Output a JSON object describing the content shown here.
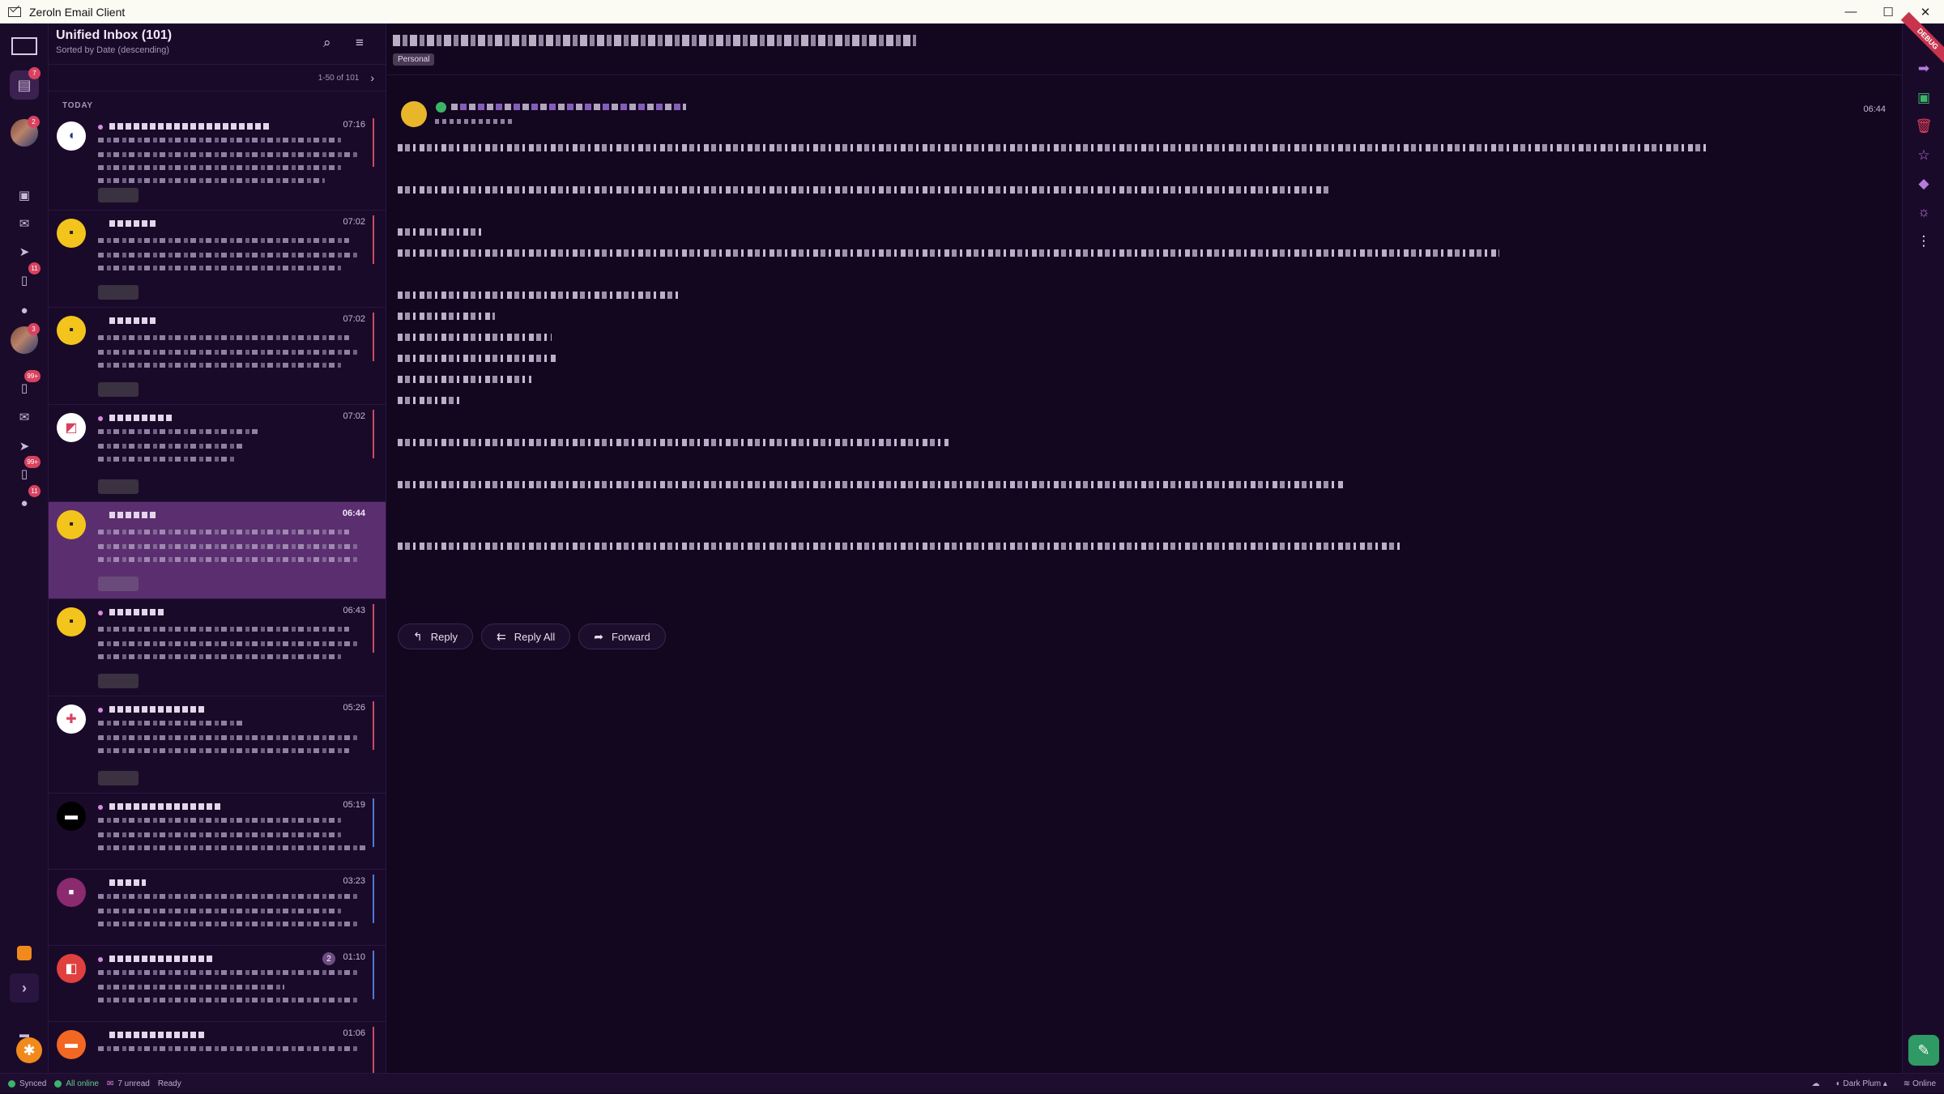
{
  "window": {
    "title": "Zeroln Email Client",
    "minimize": "—",
    "maximize": "☐",
    "close": "✕"
  },
  "rail": {
    "badges": {
      "inbox": "7",
      "account1": "2",
      "drafts1": "11",
      "account2": "3",
      "inbox2": "99+",
      "drafts2": "99+",
      "spam2": "11"
    }
  },
  "list": {
    "title": "Unified Inbox (101)",
    "subtitle": "Sorted by Date (descending)",
    "pager": "1-50 of 101",
    "group": "TODAY",
    "messages": [
      {
        "time": "07:16"
      },
      {
        "time": "07:02"
      },
      {
        "time": "07:02"
      },
      {
        "time": "07:02"
      },
      {
        "time": "06:44"
      },
      {
        "time": "06:43"
      },
      {
        "time": "05:26"
      },
      {
        "time": "05:19"
      },
      {
        "time": "03:23"
      },
      {
        "time": "01:10",
        "thread_count": "2"
      },
      {
        "time": "01:06"
      }
    ]
  },
  "reader": {
    "label": "Personal",
    "time": "06:44",
    "actions": {
      "reply": "Reply",
      "reply_all": "Reply All",
      "forward": "Forward"
    }
  },
  "status": {
    "synced": "Synced",
    "online_state": "All online",
    "unread": "7 unread",
    "ready": "Ready",
    "theme": "Dark Plum",
    "network": "Online"
  },
  "colors": {
    "accent": "#5b2f6f",
    "background": "#13061f",
    "unread_dot": "#d98ae2",
    "compose": "#2f9a63",
    "debug": "#c9344d"
  }
}
